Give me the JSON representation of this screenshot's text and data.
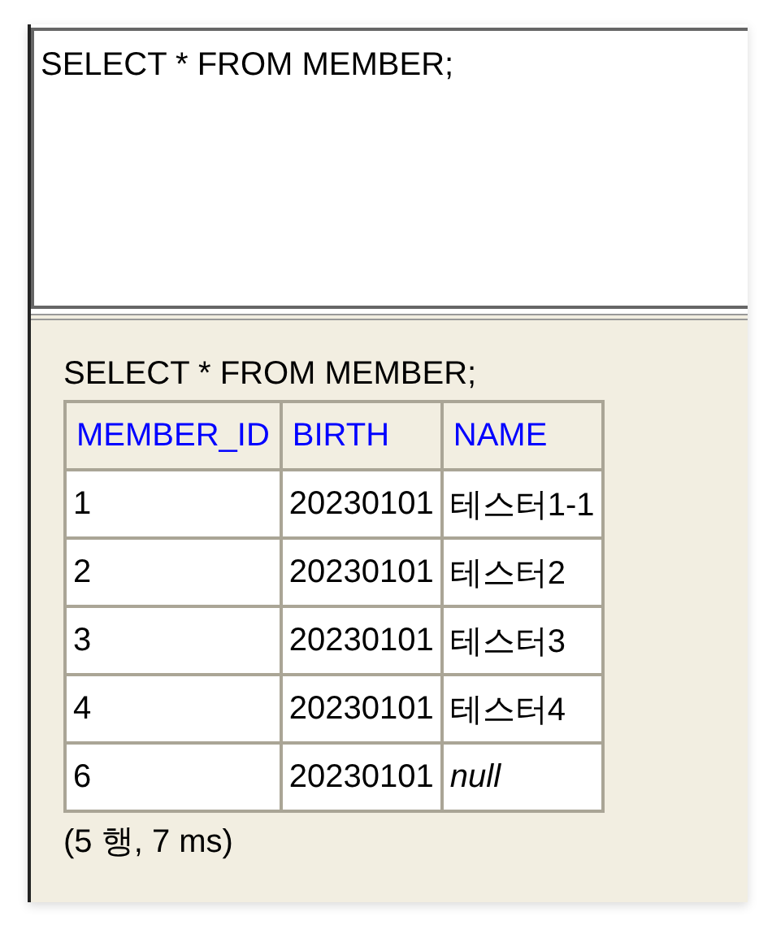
{
  "editor": {
    "value": "SELECT * FROM MEMBER;"
  },
  "result": {
    "statement": "SELECT * FROM MEMBER;",
    "columns": [
      "MEMBER_ID",
      "BIRTH",
      "NAME"
    ],
    "rows": [
      {
        "cells": [
          {
            "text": "1",
            "kind": "value"
          },
          {
            "text": "20230101",
            "kind": "value"
          },
          {
            "text": "테스터1-1",
            "kind": "value"
          }
        ]
      },
      {
        "cells": [
          {
            "text": "2",
            "kind": "value"
          },
          {
            "text": "20230101",
            "kind": "value"
          },
          {
            "text": "테스터2",
            "kind": "value"
          }
        ]
      },
      {
        "cells": [
          {
            "text": "3",
            "kind": "value"
          },
          {
            "text": "20230101",
            "kind": "value"
          },
          {
            "text": "테스터3",
            "kind": "value"
          }
        ]
      },
      {
        "cells": [
          {
            "text": "4",
            "kind": "value"
          },
          {
            "text": "20230101",
            "kind": "value"
          },
          {
            "text": "테스터4",
            "kind": "value"
          }
        ]
      },
      {
        "cells": [
          {
            "text": "6",
            "kind": "value"
          },
          {
            "text": "20230101",
            "kind": "value"
          },
          {
            "text": "null",
            "kind": "null"
          }
        ]
      }
    ],
    "summary": "(5 행, 7 ms)"
  }
}
